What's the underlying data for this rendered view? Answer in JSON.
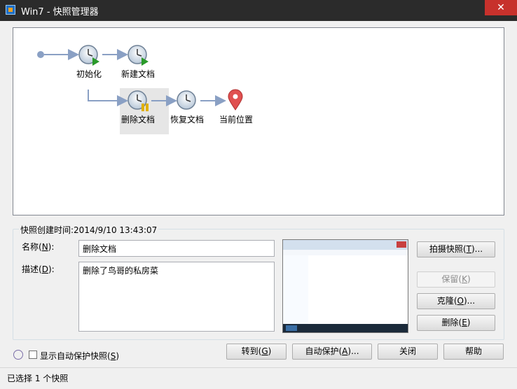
{
  "window": {
    "title": "Win7 - 快照管理器",
    "close_label": "✕"
  },
  "tree": {
    "nodes": [
      {
        "label": "初始化",
        "kind": "snapshot"
      },
      {
        "label": "新建文档",
        "kind": "snapshot"
      },
      {
        "label": "删除文档",
        "kind": "snapshot-paused",
        "selected": true
      },
      {
        "label": "恢复文档",
        "kind": "snapshot"
      },
      {
        "label": "当前位置",
        "kind": "current"
      }
    ]
  },
  "details": {
    "legend": "快照创建时间:2014/9/10 13:43:07",
    "name_label": "名称(N):",
    "name_value": "删除文档",
    "desc_label": "描述(D):",
    "desc_value": "删除了鸟哥的私房菜"
  },
  "buttons": {
    "take": "拍摄快照(T)...",
    "keep": "保留(K)",
    "clone": "克隆(O)...",
    "delete": "删除(E)",
    "goto": "转到(G)",
    "autoprotect": "自动保护(A)...",
    "close": "关闭",
    "help": "帮助"
  },
  "checkbox": {
    "label": "显示自动保护快照(S)",
    "checked": false
  },
  "status": {
    "text": "已选择 1 个快照"
  },
  "colors": {
    "titlebar": "#2b2b2b",
    "close": "#c7312c",
    "connector": "#8aa0c4",
    "accent": "#2a8a2a"
  }
}
